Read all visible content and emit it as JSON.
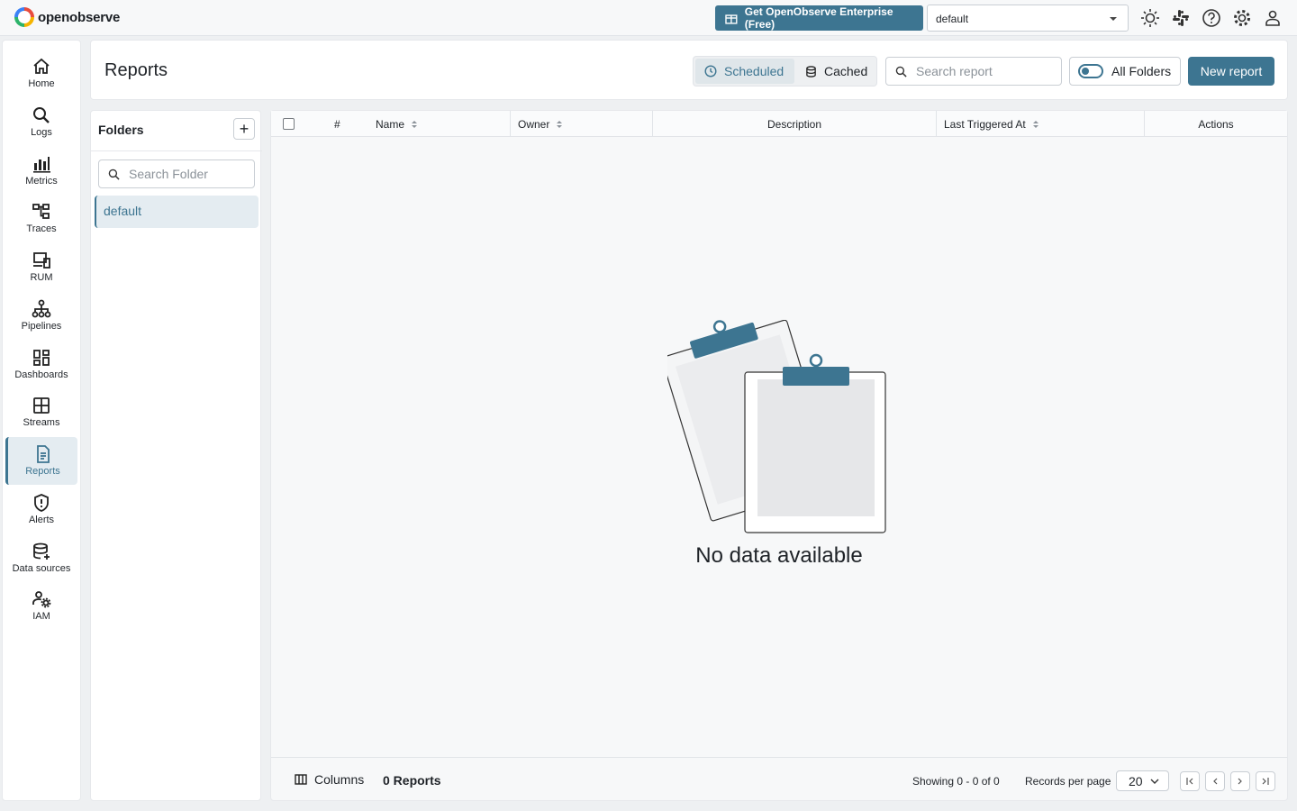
{
  "app": {
    "logo_text": "openobserve"
  },
  "topbar": {
    "enterprise_label": "Get OpenObserve Enterprise (Free)",
    "org_value": "default",
    "icons": [
      "theme-icon",
      "slack-icon",
      "help-icon",
      "settings-icon",
      "user-icon"
    ]
  },
  "nav": {
    "items": [
      {
        "label": "Home",
        "icon": "home-icon"
      },
      {
        "label": "Logs",
        "icon": "search-icon"
      },
      {
        "label": "Metrics",
        "icon": "bar-chart-icon"
      },
      {
        "label": "Traces",
        "icon": "traces-icon"
      },
      {
        "label": "RUM",
        "icon": "devices-icon"
      },
      {
        "label": "Pipelines",
        "icon": "pipeline-icon"
      },
      {
        "label": "Dashboards",
        "icon": "dashboard-icon"
      },
      {
        "label": "Streams",
        "icon": "grid-icon"
      },
      {
        "label": "Reports",
        "icon": "document-icon"
      },
      {
        "label": "Alerts",
        "icon": "alert-icon"
      },
      {
        "label": "Data sources",
        "icon": "database-icon"
      },
      {
        "label": "IAM",
        "icon": "users-gear-icon"
      }
    ],
    "active": "Reports"
  },
  "header": {
    "title": "Reports",
    "tabs": [
      {
        "label": "Scheduled",
        "selected": true
      },
      {
        "label": "Cached",
        "selected": false
      }
    ],
    "search_placeholder": "Search report",
    "all_folders_label": "All Folders",
    "new_report_label": "New report"
  },
  "folders": {
    "title": "Folders",
    "add_label": "+",
    "search_placeholder": "Search Folder",
    "items": [
      {
        "label": "default",
        "selected": true
      }
    ]
  },
  "table": {
    "columns": [
      "#",
      "Name",
      "Owner",
      "Description",
      "Last Triggered At",
      "Actions"
    ],
    "empty_text": "No data available",
    "footer": {
      "columns_label": "Columns",
      "reports_count": "0 Reports",
      "showing": "Showing 0 - 0 of 0",
      "records_per_page_label": "Records per page",
      "records_per_page_value": "20"
    }
  },
  "colors": {
    "accent": "#3d7591",
    "active_bg": "#e4ecf1"
  }
}
